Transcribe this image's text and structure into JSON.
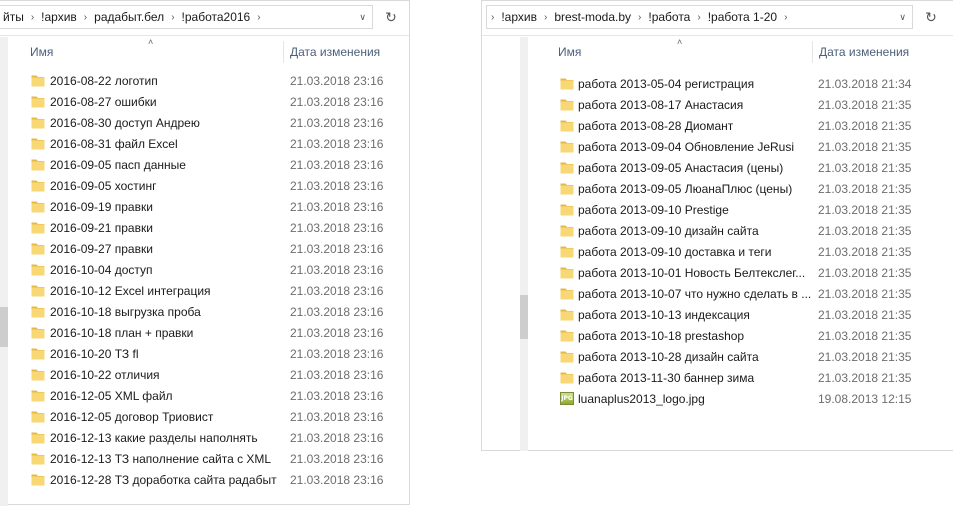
{
  "left": {
    "breadcrumb": [
      "йты",
      "!архив",
      "радабыт.бел",
      "!работа2016"
    ],
    "columns": {
      "name": "Имя",
      "date": "Дата изменения"
    },
    "items": [
      {
        "name": "2016-08-22 логотип",
        "date": "21.03.2018 23:16",
        "type": "folder"
      },
      {
        "name": "2016-08-27 ошибки",
        "date": "21.03.2018 23:16",
        "type": "folder"
      },
      {
        "name": "2016-08-30 доступ Андрею",
        "date": "21.03.2018 23:16",
        "type": "folder"
      },
      {
        "name": "2016-08-31 файл Excel",
        "date": "21.03.2018 23:16",
        "type": "folder"
      },
      {
        "name": "2016-09-05 пасп данные",
        "date": "21.03.2018 23:16",
        "type": "folder"
      },
      {
        "name": "2016-09-05 хостинг",
        "date": "21.03.2018 23:16",
        "type": "folder"
      },
      {
        "name": "2016-09-19 правки",
        "date": "21.03.2018 23:16",
        "type": "folder"
      },
      {
        "name": "2016-09-21 правки",
        "date": "21.03.2018 23:16",
        "type": "folder"
      },
      {
        "name": "2016-09-27 правки",
        "date": "21.03.2018 23:16",
        "type": "folder"
      },
      {
        "name": "2016-10-04 доступ",
        "date": "21.03.2018 23:16",
        "type": "folder"
      },
      {
        "name": "2016-10-12 Excel интеграция",
        "date": "21.03.2018 23:16",
        "type": "folder"
      },
      {
        "name": "2016-10-18 выгрузка проба",
        "date": "21.03.2018 23:16",
        "type": "folder"
      },
      {
        "name": "2016-10-18 план + правки",
        "date": "21.03.2018 23:16",
        "type": "folder"
      },
      {
        "name": "2016-10-20 ТЗ fl",
        "date": "21.03.2018 23:16",
        "type": "folder"
      },
      {
        "name": "2016-10-22 отличия",
        "date": "21.03.2018 23:16",
        "type": "folder"
      },
      {
        "name": "2016-12-05 XML файл",
        "date": "21.03.2018 23:16",
        "type": "folder"
      },
      {
        "name": "2016-12-05 договор Триовист",
        "date": "21.03.2018 23:16",
        "type": "folder"
      },
      {
        "name": "2016-12-13 какие разделы наполнять",
        "date": "21.03.2018 23:16",
        "type": "folder"
      },
      {
        "name": "2016-12-13 ТЗ наполнение сайта с XML",
        "date": "21.03.2018 23:16",
        "type": "folder"
      },
      {
        "name": "2016-12-28 ТЗ доработка сайта радабыт",
        "date": "21.03.2018 23:16",
        "type": "folder"
      }
    ]
  },
  "right": {
    "breadcrumb": [
      "!архив",
      "brest-moda.by",
      "!работа",
      "!работа 1-20"
    ],
    "columns": {
      "name": "Имя",
      "date": "Дата изменения"
    },
    "items": [
      {
        "name": "работа 2013-05-04 регистрация",
        "date": "21.03.2018 21:34",
        "type": "folder"
      },
      {
        "name": "работа 2013-08-17 Анастасия",
        "date": "21.03.2018 21:35",
        "type": "folder"
      },
      {
        "name": "работа 2013-08-28 Диомант",
        "date": "21.03.2018 21:35",
        "type": "folder"
      },
      {
        "name": "работа 2013-09-04 Обновление JeRusi",
        "date": "21.03.2018 21:35",
        "type": "folder"
      },
      {
        "name": "работа 2013-09-05 Анастасия (цены)",
        "date": "21.03.2018 21:35",
        "type": "folder"
      },
      {
        "name": "работа 2013-09-05 ЛюанаПлюс (цены)",
        "date": "21.03.2018 21:35",
        "type": "folder"
      },
      {
        "name": "работа 2013-09-10 Prestige",
        "date": "21.03.2018 21:35",
        "type": "folder"
      },
      {
        "name": "работа 2013-09-10 дизайн сайта",
        "date": "21.03.2018 21:35",
        "type": "folder"
      },
      {
        "name": "работа 2013-09-10 доставка и теги",
        "date": "21.03.2018 21:35",
        "type": "folder"
      },
      {
        "name": "работа 2013-10-01 Новость Белтекслег...",
        "date": "21.03.2018 21:35",
        "type": "folder"
      },
      {
        "name": "работа 2013-10-07 что нужно сделать в ...",
        "date": "21.03.2018 21:35",
        "type": "folder"
      },
      {
        "name": "работа 2013-10-13 индексация",
        "date": "21.03.2018 21:35",
        "type": "folder"
      },
      {
        "name": "работа 2013-10-18 prestashop",
        "date": "21.03.2018 21:35",
        "type": "folder"
      },
      {
        "name": "работа 2013-10-28 дизайн сайта",
        "date": "21.03.2018 21:35",
        "type": "folder"
      },
      {
        "name": "работа 2013-11-30 баннер зима",
        "date": "21.03.2018 21:35",
        "type": "folder"
      },
      {
        "name": "luanaplus2013_logo.jpg",
        "date": "19.08.2013 12:15",
        "type": "jpg"
      }
    ]
  },
  "icons": {
    "folder": "folder-icon",
    "jpg": "jpg-file-icon",
    "refresh": "refresh-icon",
    "sort": "sort-ascending-icon",
    "chevron": "chevron-right-icon",
    "dropdown": "chevron-down-icon"
  },
  "jpg_badge": "JPG",
  "colors": {
    "folder": "#f8d775",
    "folder_dark": "#e6b84a",
    "header_text": "#4c607a"
  }
}
